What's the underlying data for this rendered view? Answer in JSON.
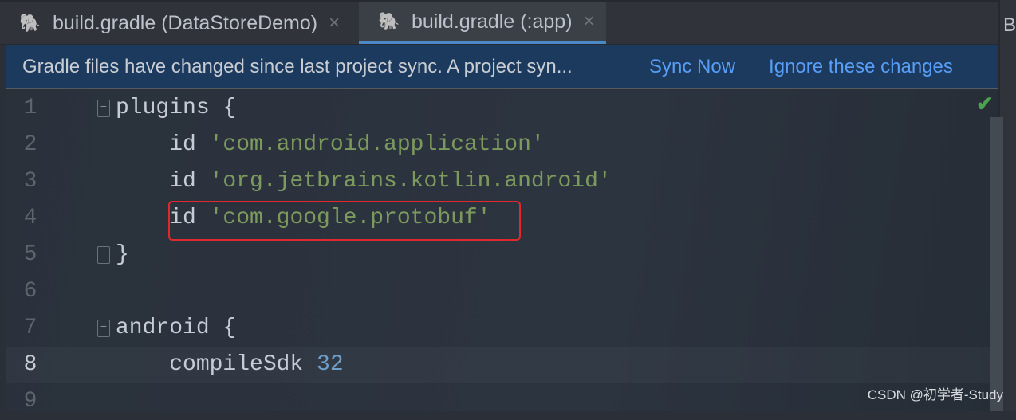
{
  "tabs": [
    {
      "label": "build.gradle (DataStoreDemo)",
      "icon": "gradle-elephant-icon",
      "active": false
    },
    {
      "label": "build.gradle (:app)",
      "icon": "gradle-elephant-icon",
      "active": true
    }
  ],
  "close_glyph": "×",
  "right_panel_letter": "B",
  "banner": {
    "message": "Gradle files have changed since last project sync. A project syn...",
    "sync_now": "Sync Now",
    "ignore": "Ignore these changes"
  },
  "editor": {
    "current_line": "8",
    "lines": [
      {
        "n": "1",
        "pre": "plugins {",
        "str": "",
        "post": ""
      },
      {
        "n": "2",
        "pre": "    id ",
        "str": "'com.android.application'",
        "post": ""
      },
      {
        "n": "3",
        "pre": "    id ",
        "str": "'org.jetbrains.kotlin.android'",
        "post": ""
      },
      {
        "n": "4",
        "pre": "    id ",
        "str": "'com.google.protobuf'",
        "post": ""
      },
      {
        "n": "5",
        "pre": "}",
        "str": "",
        "post": ""
      },
      {
        "n": "6",
        "pre": "",
        "str": "",
        "post": ""
      },
      {
        "n": "7",
        "pre": "android {",
        "str": "",
        "post": ""
      },
      {
        "n": "8",
        "pre": "    compileSdk ",
        "str": "",
        "post": "32"
      },
      {
        "n": "9",
        "pre": "",
        "str": "",
        "post": ""
      }
    ],
    "inspection_status": "check-icon"
  },
  "watermark": "CSDN @初学者-Study",
  "colors": {
    "accent": "#4a88c7",
    "link": "#589df6",
    "string": "#7c9a5d",
    "highlight_box": "#e0282d"
  }
}
